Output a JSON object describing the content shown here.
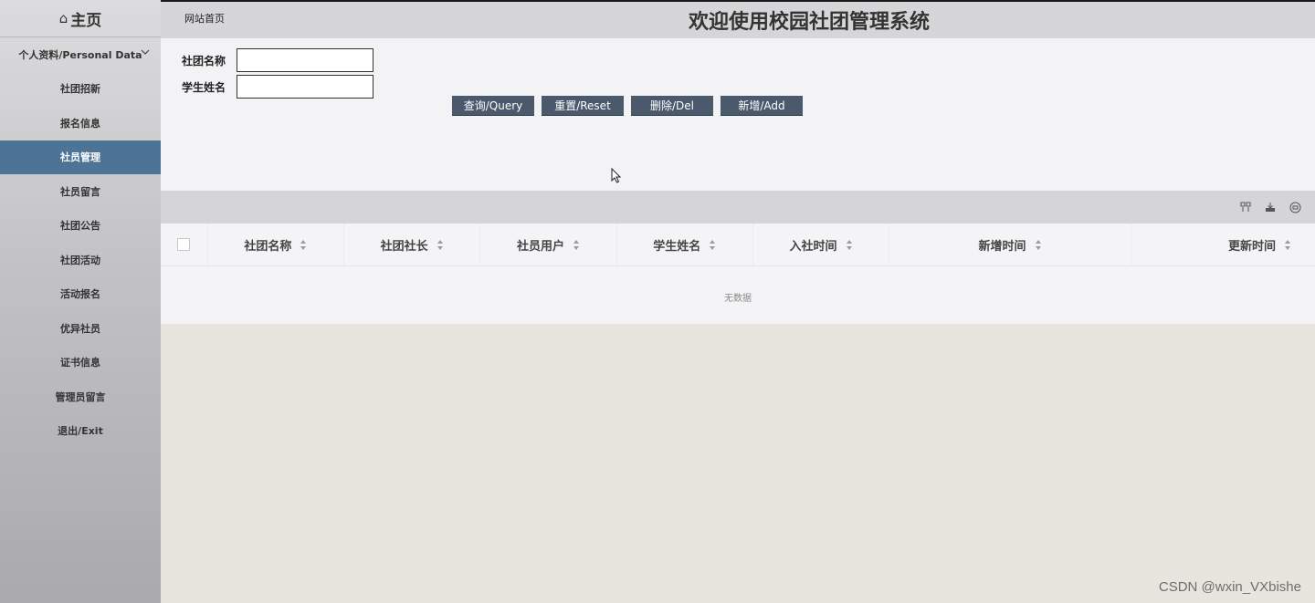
{
  "sidebar": {
    "home_icon": "home-icon",
    "home_label": "主页",
    "items": [
      {
        "label": "个人资料/Personal Data",
        "expandable": true
      },
      {
        "label": "社团招新"
      },
      {
        "label": "报名信息"
      },
      {
        "label": "社员管理",
        "active": true
      },
      {
        "label": "社员留言"
      },
      {
        "label": "社团公告"
      },
      {
        "label": "社团活动"
      },
      {
        "label": "活动报名"
      },
      {
        "label": "优异社员"
      },
      {
        "label": "证书信息"
      },
      {
        "label": "管理员留言"
      },
      {
        "label": "退出/Exit"
      }
    ]
  },
  "header": {
    "site_home": "网站首页",
    "title": "欢迎使用校园社团管理系统"
  },
  "search": {
    "club_name_label": "社团名称",
    "club_name_value": "",
    "student_name_label": "学生姓名",
    "student_name_value": "",
    "buttons": {
      "query": "查询/Query",
      "reset": "重置/Reset",
      "delete": "删除/Del",
      "add": "新增/Add"
    }
  },
  "table": {
    "columns": [
      "社团名称",
      "社团社长",
      "社员用户",
      "学生姓名",
      "入社时间",
      "新增时间",
      "更新时间"
    ],
    "empty_text": "无数据",
    "rows": []
  },
  "watermark": "CSDN @wxin_VXbishe",
  "colors": {
    "active_nav": "#4d7397",
    "button": "#4a5a6c",
    "header": "#d6d6d9"
  }
}
